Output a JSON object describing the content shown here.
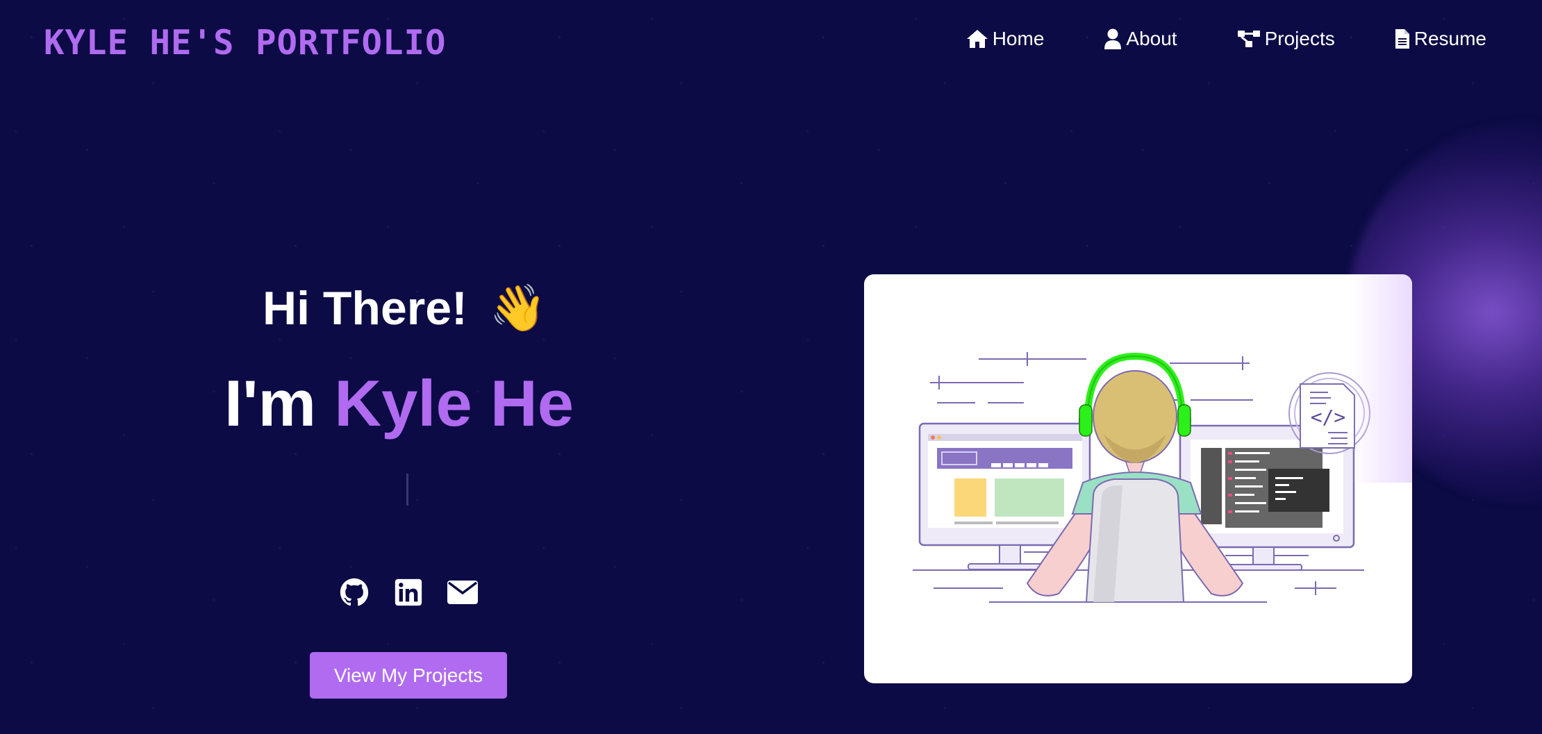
{
  "brand": {
    "title": "KYLE HE'S PORTFOLIO"
  },
  "nav": {
    "items": [
      {
        "label": "Home",
        "icon": "home-icon"
      },
      {
        "label": "About",
        "icon": "user-icon"
      },
      {
        "label": "Projects",
        "icon": "project-diagram-icon"
      },
      {
        "label": "Resume",
        "icon": "file-icon"
      }
    ]
  },
  "hero": {
    "greeting": "Hi There!",
    "wave_emoji": "👋",
    "intro_prefix": "I'm",
    "name": "Kyle He",
    "cta_label": "View My Projects"
  },
  "socials": [
    {
      "icon": "github-icon"
    },
    {
      "icon": "linkedin-icon"
    },
    {
      "icon": "email-icon"
    }
  ],
  "illustration": {
    "code_badge": "</>"
  },
  "colors": {
    "background": "#0c0b45",
    "accent": "#b06bf0",
    "text": "#ffffff",
    "headphones": "#2cf01a"
  }
}
